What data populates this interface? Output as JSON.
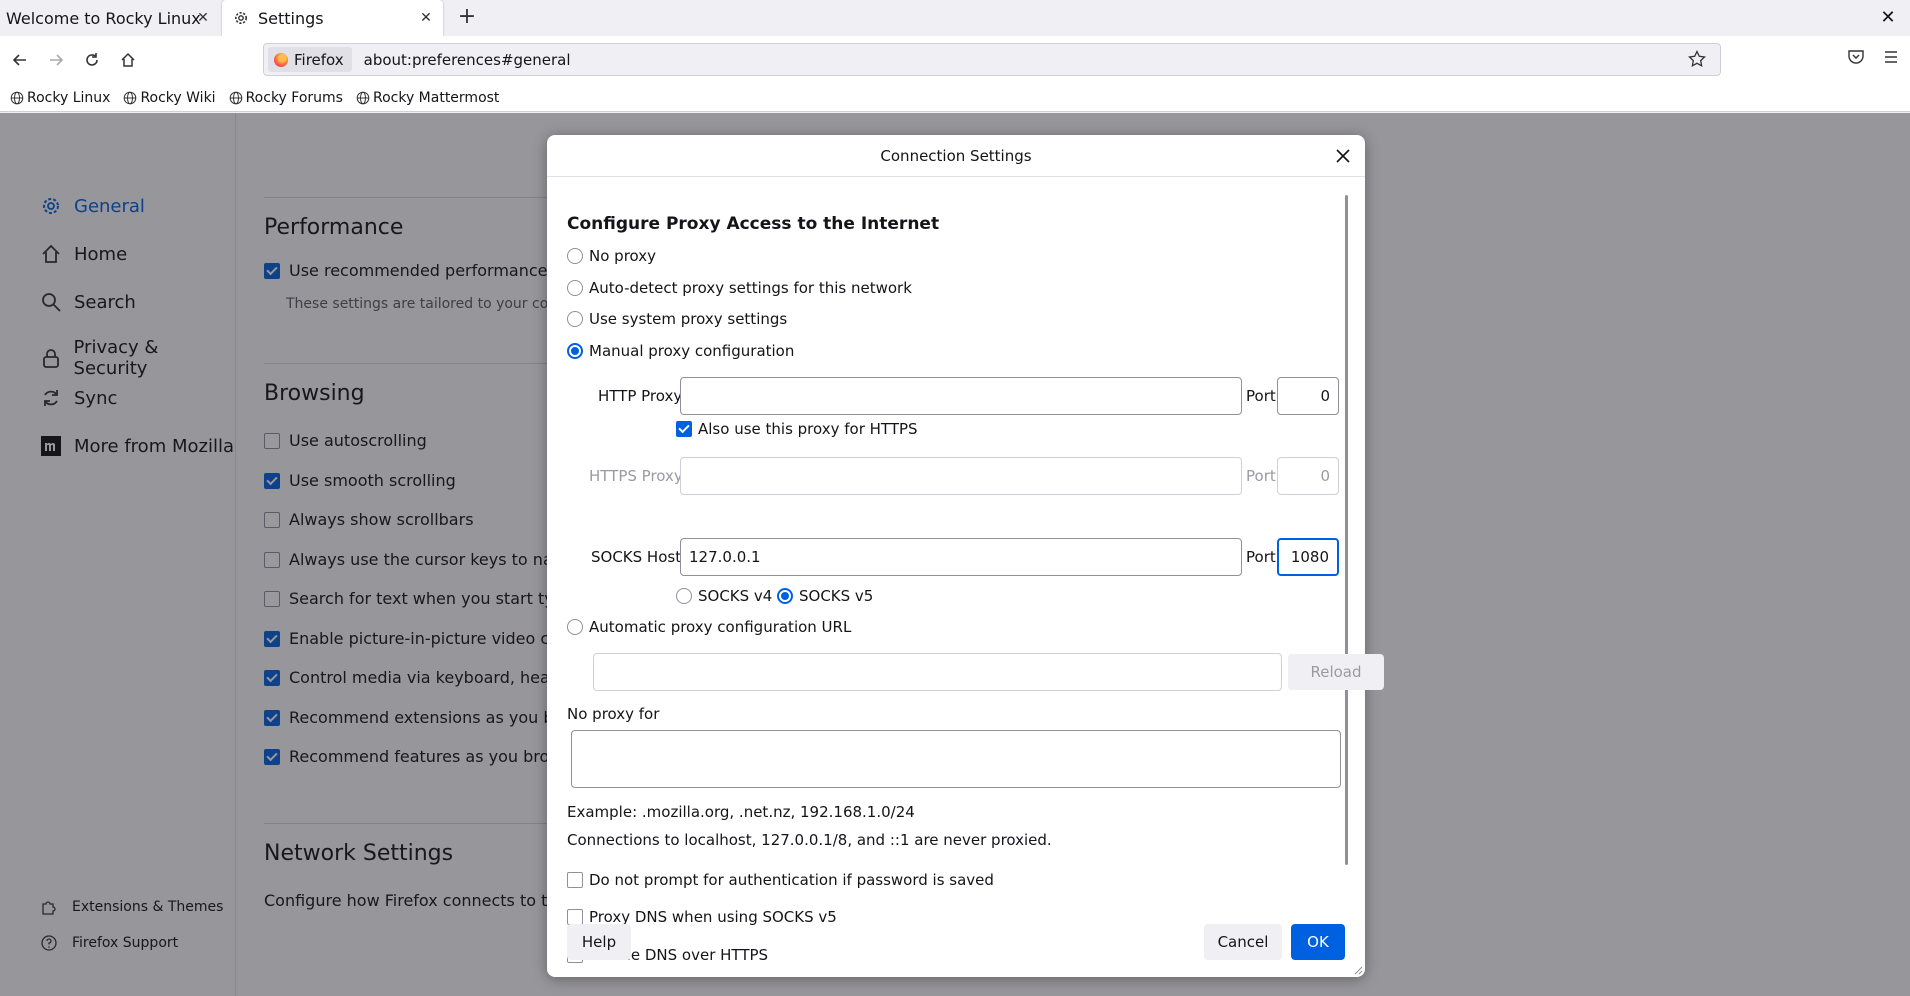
{
  "browser": {
    "tabs": [
      {
        "title": "Welcome to Rocky Linux"
      },
      {
        "title": "Settings"
      }
    ],
    "url": "about:preferences#general",
    "identity_label": "Firefox",
    "bookmarks": [
      "Rocky Linux",
      "Rocky Wiki",
      "Rocky Forums",
      "Rocky Mattermost"
    ]
  },
  "sidebar": {
    "items": [
      {
        "label": "General",
        "icon": "gear-icon"
      },
      {
        "label": "Home",
        "icon": "home-icon"
      },
      {
        "label": "Search",
        "icon": "search-icon"
      },
      {
        "label": "Privacy & Security",
        "icon": "lock-icon"
      },
      {
        "label": "Sync",
        "icon": "sync-icon"
      },
      {
        "label": "More from Mozilla",
        "icon": "mozilla-icon"
      }
    ],
    "footer": [
      {
        "label": "Extensions & Themes",
        "icon": "puzzle-icon"
      },
      {
        "label": "Firefox Support",
        "icon": "help-icon"
      }
    ]
  },
  "content": {
    "performance": {
      "heading": "Performance",
      "recommended": "Use recommended performance sett",
      "note": "These settings are tailored to your comp"
    },
    "browsing": {
      "heading": "Browsing",
      "items": [
        {
          "label": "Use autoscrolling",
          "checked": false
        },
        {
          "label": "Use smooth scrolling",
          "checked": true
        },
        {
          "label": "Always show scrollbars",
          "checked": false
        },
        {
          "label": "Always use the cursor keys to naviga",
          "checked": false
        },
        {
          "label": "Search for text when you start typing",
          "checked": false
        },
        {
          "label": "Enable picture-in-picture video contr",
          "checked": true
        },
        {
          "label": "Control media via keyboard, headset,",
          "checked": true
        },
        {
          "label": "Recommend extensions as you brows",
          "checked": true
        },
        {
          "label": "Recommend features as you browse",
          "checked": true
        }
      ]
    },
    "network": {
      "heading": "Network Settings",
      "desc": "Configure how Firefox connects to the i"
    }
  },
  "dialog": {
    "title": "Connection Settings",
    "heading": "Configure Proxy Access to the Internet",
    "options": {
      "no_proxy": "No proxy",
      "auto_detect": "Auto-detect proxy settings for this network",
      "system": "Use system proxy settings",
      "manual": "Manual proxy configuration",
      "auto_url": "Automatic proxy configuration URL"
    },
    "http": {
      "label": "HTTP Proxy",
      "value": "",
      "port_label": "Port",
      "port": "0"
    },
    "also_https": "Also use this proxy for HTTPS",
    "https": {
      "label": "HTTPS Proxy",
      "value": "",
      "port_label": "Port",
      "port": "0"
    },
    "socks": {
      "label": "SOCKS Host",
      "value": "127.0.0.1",
      "port_label": "Port",
      "port": "1080"
    },
    "socks_v4": "SOCKS v4",
    "socks_v5": "SOCKS v5",
    "auto_url_value": "",
    "reload": "Reload",
    "no_proxy_for": "No proxy for",
    "no_proxy_value": "",
    "example": "Example: .mozilla.org, .net.nz, 192.168.1.0/24",
    "localhost_note": "Connections to localhost, 127.0.0.1/8, and ::1 are never proxied.",
    "no_auth_prompt": "Do not prompt for authentication if password is saved",
    "proxy_dns": "Proxy DNS when using SOCKS v5",
    "dns_https": "Enable DNS over HTTPS",
    "help": "Help",
    "cancel": "Cancel",
    "ok": "OK"
  },
  "colors": {
    "accent": "#0061e0",
    "overlay": "#1c1b22"
  }
}
